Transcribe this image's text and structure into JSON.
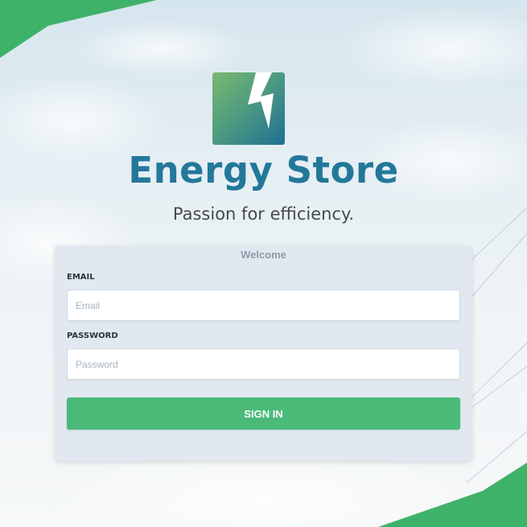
{
  "brand": {
    "name": "Energy Store",
    "tagline": "Passion for efficiency."
  },
  "login": {
    "title": "Welcome",
    "email_label": "EMAIL",
    "email_placeholder": "Email",
    "email_value": "",
    "password_label": "PASSWORD",
    "password_placeholder": "Password",
    "password_value": "",
    "submit_label": "SIGN IN"
  },
  "colors": {
    "accent_green": "#4aba79",
    "brand_teal": "#23789a",
    "card_background": "#e1e8f0",
    "decor_green": "#3fb26a"
  },
  "icons": {
    "logo": "lightning-bolt-icon"
  }
}
